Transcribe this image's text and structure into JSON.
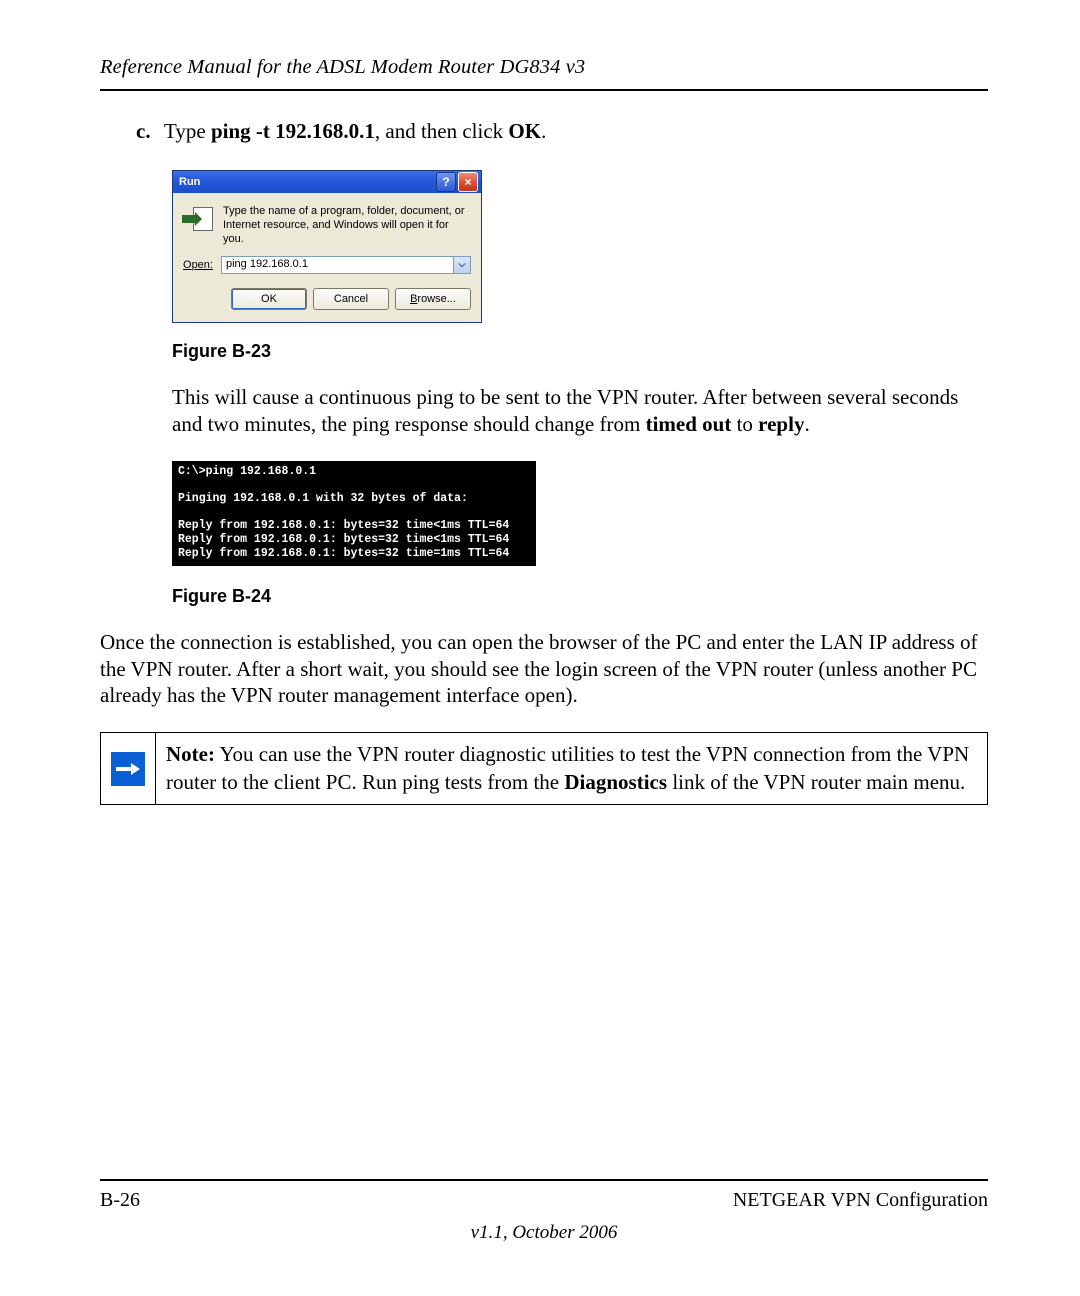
{
  "header": {
    "title": "Reference Manual for the ADSL Modem Router DG834 v3"
  },
  "step": {
    "marker": "c.",
    "prefix": "Type  ",
    "cmd": "ping -t 192.168.0.1",
    "mid": ", and then click ",
    "ok": "OK",
    "suffix": "."
  },
  "run_dialog": {
    "title": "Run",
    "help_char": "?",
    "close_char": "×",
    "desc": "Type the name of a program, folder, document, or Internet resource, and Windows will open it for you.",
    "open_label_u": "O",
    "open_label_rest": "pen:",
    "open_value": "ping 192.168.0.1",
    "btn_ok": "OK",
    "btn_cancel": "Cancel",
    "btn_browse_u": "B",
    "btn_browse_rest": "rowse..."
  },
  "fig1": "Figure B-23",
  "para1": {
    "t1": "This will cause a continuous ping to be sent to the VPN router. After between several seconds and two minutes, the ping response should change from ",
    "b1": "timed out",
    "t2": " to ",
    "b2": "reply",
    "t3": "."
  },
  "console_lines": [
    "C:\\>ping 192.168.0.1",
    "",
    "Pinging 192.168.0.1 with 32 bytes of data:",
    "",
    "Reply from 192.168.0.1: bytes=32 time<1ms TTL=64",
    "Reply from 192.168.0.1: bytes=32 time<1ms TTL=64",
    "Reply from 192.168.0.1: bytes=32 time=1ms TTL=64"
  ],
  "fig2": "Figure B-24",
  "para2": "Once the connection is established, you can open the browser of the PC and enter the LAN IP address of the VPN router. After a short wait, you should see the login screen of the VPN router (unless another PC already has the VPN router management interface open).",
  "note": {
    "label": "Note:",
    "t1": " You can use the VPN router diagnostic utilities to test the VPN connection from the VPN router to the client PC. Run ping tests from the ",
    "b1": "Diagnostics",
    "t2": " link of the VPN router main menu."
  },
  "footer": {
    "left": "B-26",
    "right": "NETGEAR VPN Configuration",
    "center": "v1.1, October 2006"
  }
}
